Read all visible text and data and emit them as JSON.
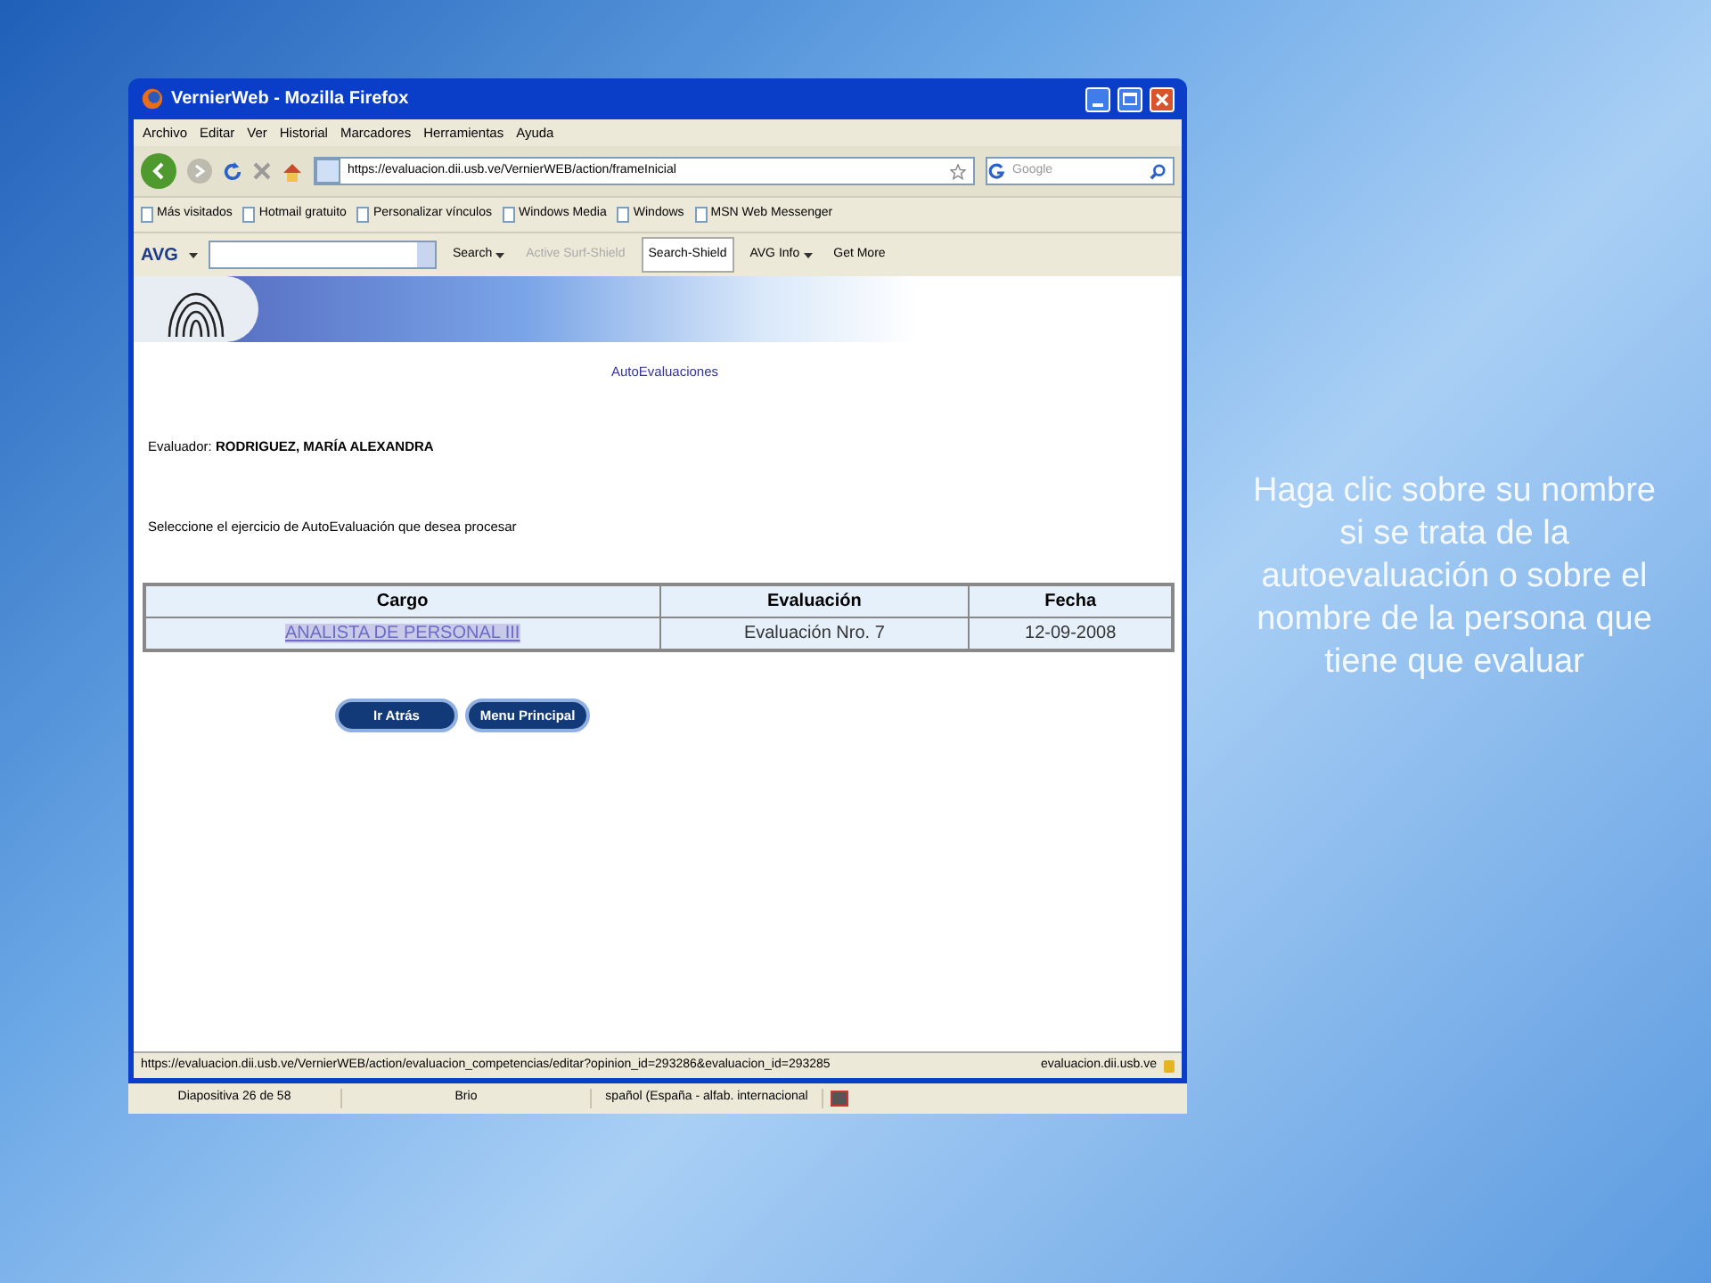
{
  "window": {
    "title": "VernierWeb - Mozilla Firefox"
  },
  "menu": [
    "Archivo",
    "Editar",
    "Ver",
    "Historial",
    "Marcadores",
    "Herramientas",
    "Ayuda"
  ],
  "navigation": {
    "url": "https://evaluacion.dii.usb.ve/VernierWEB/action/frameInicial",
    "search_placeholder": "Google"
  },
  "bookmarks": [
    "Más visitados",
    "Hotmail gratuito",
    "Personalizar vínculos",
    "Windows Media",
    "Windows",
    "MSN Web Messenger"
  ],
  "avg_toolbar": {
    "logo": "AVG",
    "items": [
      {
        "label": "Search",
        "kind": "dropdown",
        "selected": false,
        "disabled": false
      },
      {
        "label": "Active Surf-Shield",
        "kind": "plain",
        "selected": false,
        "disabled": true
      },
      {
        "label": "Search-Shield",
        "kind": "plain",
        "selected": true,
        "disabled": false
      },
      {
        "label": "AVG Info",
        "kind": "dropdown",
        "selected": false,
        "disabled": false
      },
      {
        "label": "Get More",
        "kind": "plain",
        "selected": false,
        "disabled": false
      }
    ]
  },
  "page": {
    "heading": "AutoEvaluaciones",
    "evaluator_label": "Evaluador:",
    "evaluator_name": "RODRIGUEZ, MARÍA ALEXANDRA",
    "instruction": "Seleccione el ejercicio de AutoEvaluación que desea procesar",
    "table": {
      "columns": [
        "Cargo",
        "Evaluación",
        "Fecha"
      ],
      "rows": [
        [
          "ANALISTA DE PERSONAL III",
          "Evaluación Nro. 7",
          "12-09-2008"
        ]
      ]
    },
    "buttons": [
      "Ir Atrás",
      "Menu Principal"
    ]
  },
  "status_bar": {
    "url": "https://evaluacion.dii.usb.ve/VernierWEB/action/evaluacion_competencias/editar?opinion_id=293286&evaluacion_id=293285",
    "domain": "evaluacion.dii.usb.ve"
  },
  "slide_status_bar": [
    "Diapositiva 26 de 58",
    "Brio",
    "spañol (España - alfab. internacional"
  ],
  "caption": "Haga clic sobre su nombre si se trata de la autoevaluación o sobre el nombre de la persona que tiene que evaluar"
}
